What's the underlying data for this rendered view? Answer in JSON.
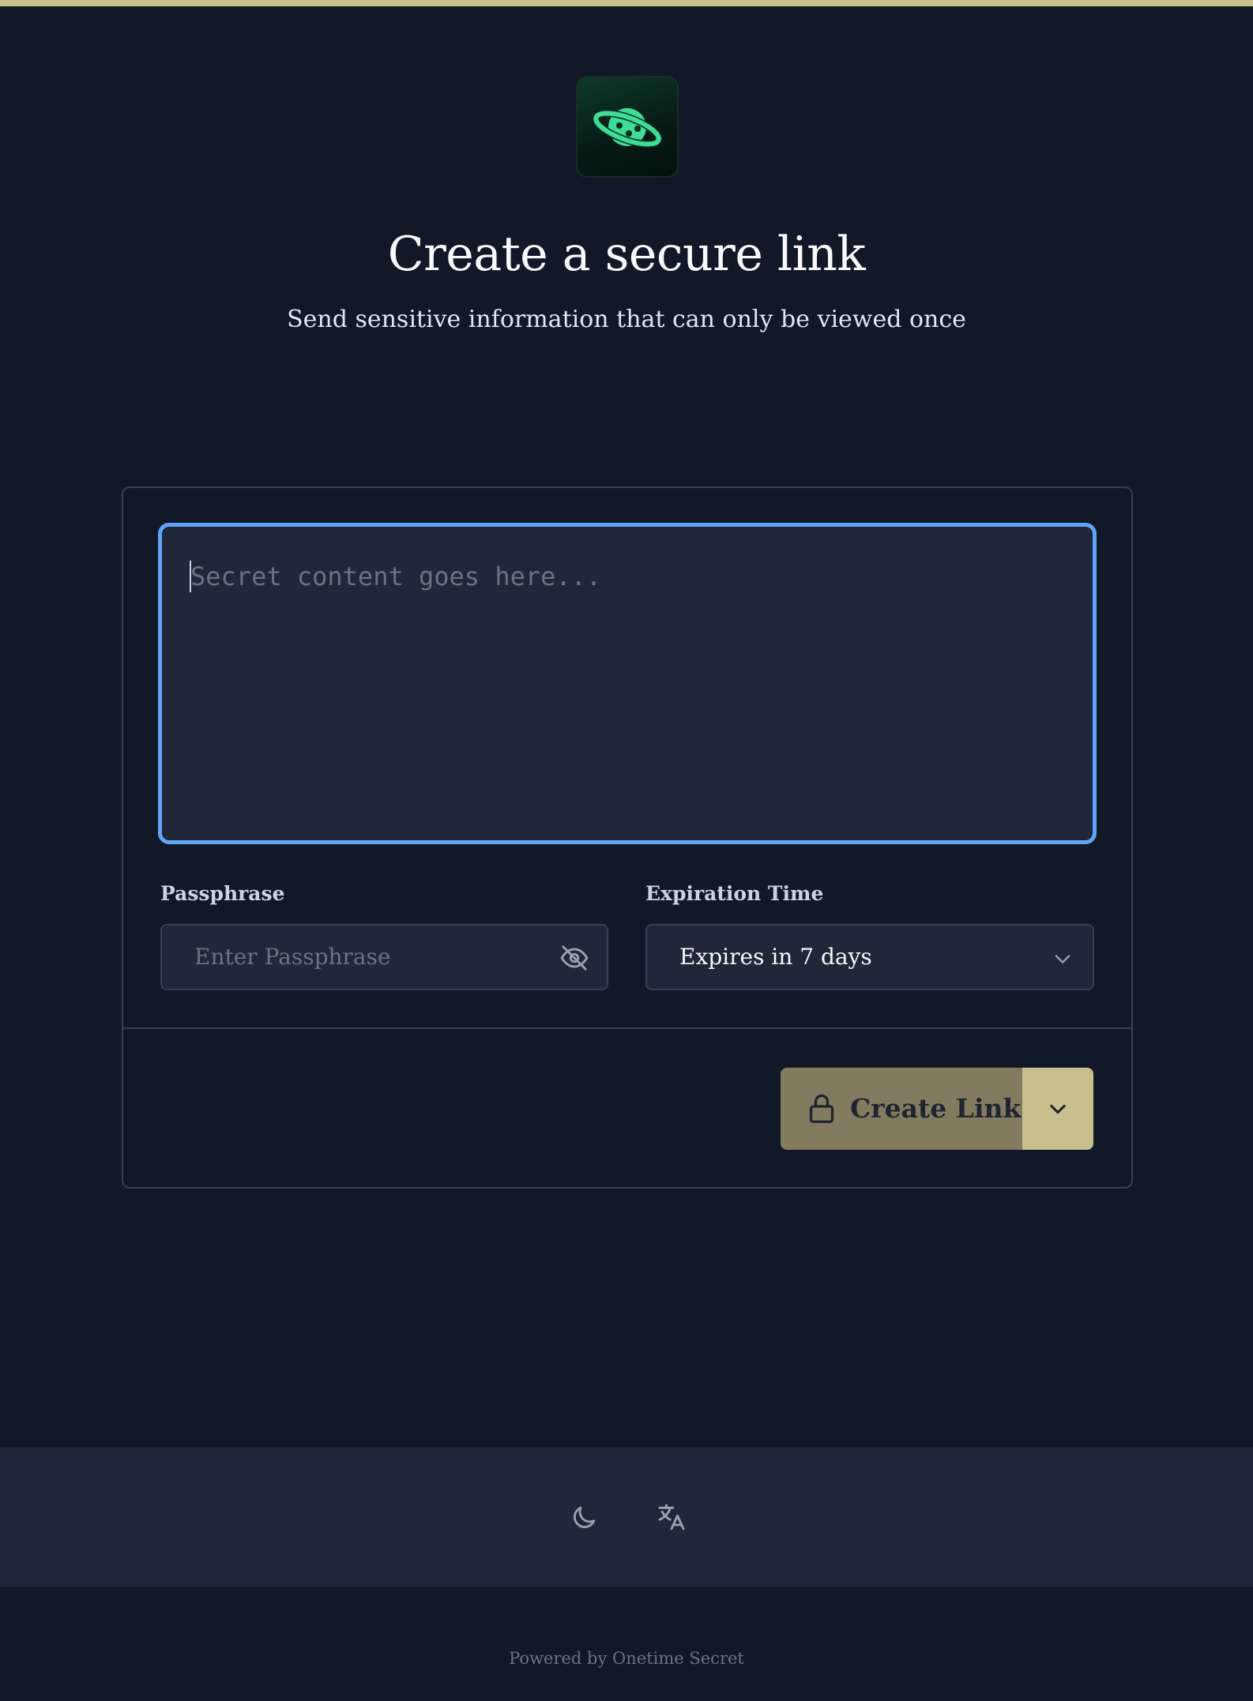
{
  "header": {
    "logo_icon": "planet-icon",
    "title": "Create a secure link",
    "subtitle": "Send sensitive information that can only be viewed once"
  },
  "form": {
    "secret": {
      "placeholder": "Secret content goes here...",
      "value": ""
    },
    "passphrase": {
      "label": "Passphrase",
      "placeholder": "Enter Passphrase",
      "value": "",
      "toggle_icon": "eye-off-icon"
    },
    "expiration": {
      "label": "Expiration Time",
      "selected": "Expires in 7 days",
      "icon": "chevron-down-icon"
    },
    "submit": {
      "label": "Create Link",
      "icon": "lock-icon",
      "dropdown_icon": "chevron-down-icon"
    }
  },
  "footer": {
    "theme_icon": "moon-icon",
    "language_icon": "translate-icon",
    "powered_by": "Powered by Onetime Secret"
  },
  "colors": {
    "background": "#111827",
    "panel": "#1f2738",
    "accent": "#c9bf8e",
    "focus_ring": "#60a5fa",
    "logo_green": "#3ddc97"
  }
}
